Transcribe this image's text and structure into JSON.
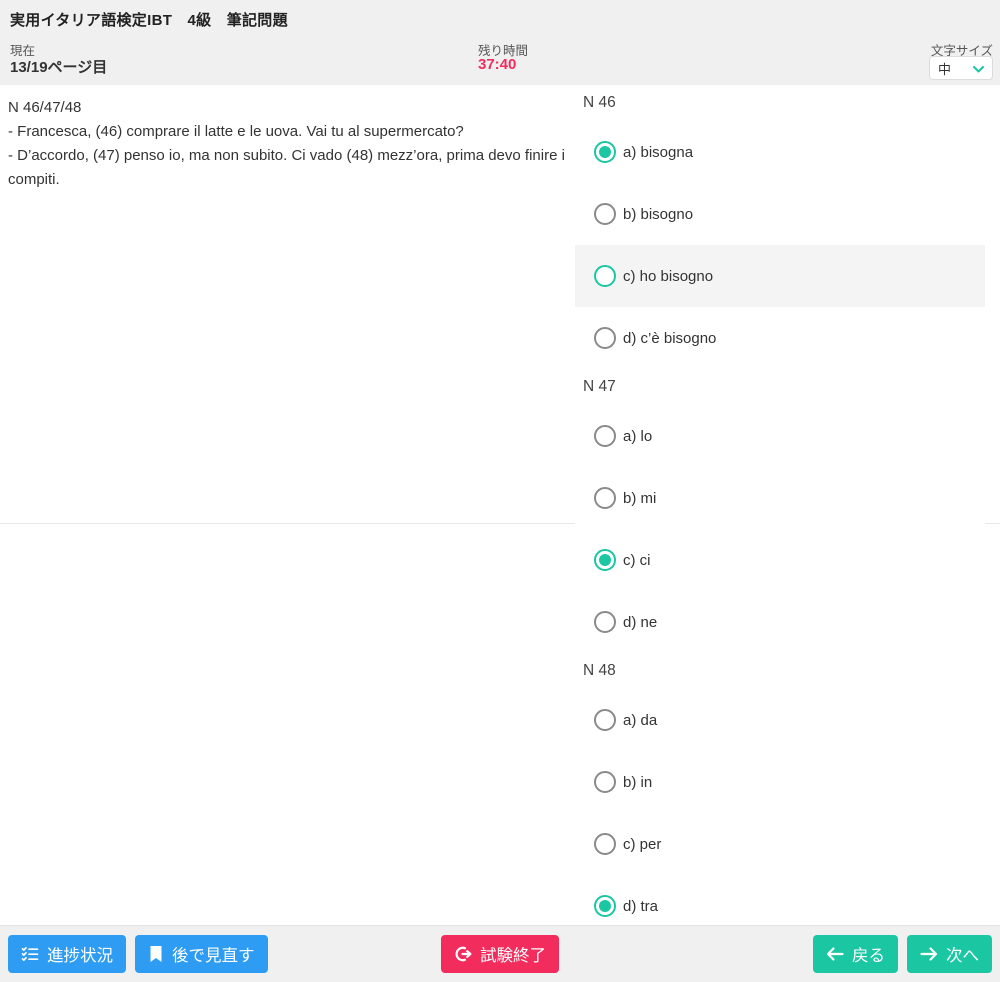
{
  "colors": {
    "teal": "#1bc7a3",
    "blue": "#2d9cf2",
    "red": "#f22c5c",
    "header-bg": "#f0f0f0",
    "hover-bg": "#f4f4f4",
    "divider": "#e8e8e8",
    "radio-border": "#8a8a8a"
  },
  "header": {
    "title": "実用イタリア語検定IBT　4級　筆記問題",
    "current_label": "現在",
    "current_value": "13/19ページ目",
    "time_label": "残り時間",
    "time_value": "37:40",
    "font_size_label": "文字サイズ",
    "font_size_value": "中"
  },
  "question": {
    "number": "N 46/47/48",
    "line1": "- Francesca, (46) comprare il latte e le uova. Vai tu al supermercato?",
    "line2": "- D’accordo, (47) penso io, ma non subito. Ci vado (48) mezz’ora, prima devo finire i compiti."
  },
  "groups": [
    {
      "title": "N 46",
      "options": [
        {
          "label": "a) bisogna",
          "state": "selected"
        },
        {
          "label": "b) bisogno",
          "state": "default"
        },
        {
          "label": "c) ho bisogno",
          "state": "hover"
        },
        {
          "label": "d) c’è bisogno",
          "state": "default"
        }
      ]
    },
    {
      "title": "N 47",
      "options": [
        {
          "label": "a) lo",
          "state": "default"
        },
        {
          "label": "b) mi",
          "state": "default"
        },
        {
          "label": "c) ci",
          "state": "selected"
        },
        {
          "label": "d) ne",
          "state": "default"
        }
      ]
    },
    {
      "title": "N 48",
      "options": [
        {
          "label": "a) da",
          "state": "default"
        },
        {
          "label": "b) in",
          "state": "default"
        },
        {
          "label": "c) per",
          "state": "default"
        },
        {
          "label": "d) tra",
          "state": "selected"
        }
      ]
    }
  ],
  "footer": {
    "progress_label": "進捗状況",
    "review_label": "後で見直す",
    "finish_label": "試験終了",
    "back_label": "戻る",
    "next_label": "次へ"
  }
}
